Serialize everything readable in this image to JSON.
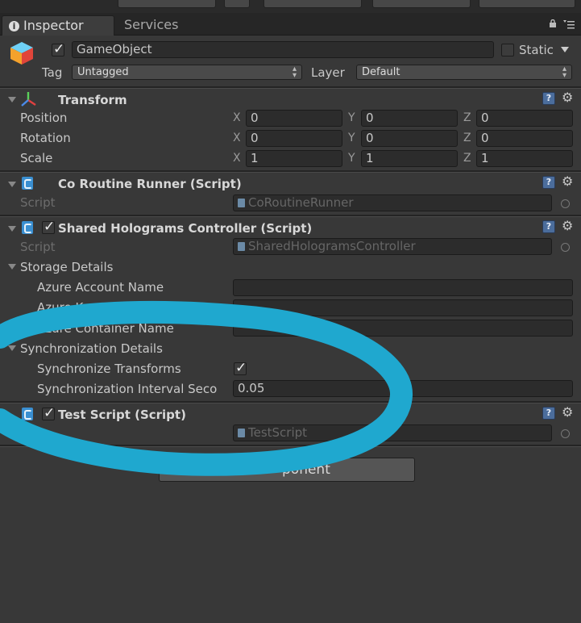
{
  "tabs": [
    {
      "label": "Inspector",
      "active": true
    },
    {
      "label": "Services",
      "active": false
    }
  ],
  "header": {
    "object_name": "GameObject",
    "active": true,
    "static_label": "Static",
    "tag_label": "Tag",
    "tag_value": "Untagged",
    "layer_label": "Layer",
    "layer_value": "Default"
  },
  "transform": {
    "title": "Transform",
    "rows": [
      {
        "label": "Position",
        "x": "0",
        "y": "0",
        "z": "0"
      },
      {
        "label": "Rotation",
        "x": "0",
        "y": "0",
        "z": "0"
      },
      {
        "label": "Scale",
        "x": "1",
        "y": "1",
        "z": "1"
      }
    ],
    "axis_x": "X",
    "axis_y": "Y",
    "axis_z": "Z"
  },
  "components": {
    "coroutine": {
      "title": "Co Routine Runner (Script)",
      "script_label": "Script",
      "script_value": "CoRoutineRunner"
    },
    "shared": {
      "title": "Shared Holograms Controller (Script)",
      "script_label": "Script",
      "script_value": "SharedHologramsController",
      "storage_title": "Storage Details",
      "azure_account": "Azure Account Name",
      "azure_key": "Azure Key Base 64",
      "azure_container": "Azure Container Name",
      "sync_title": "Synchronization Details",
      "sync_transforms": "Synchronize Transforms",
      "sync_interval": "Synchronization Interval Seco",
      "sync_interval_value": "0.05"
    },
    "test": {
      "title": "Test Script (Script)",
      "script_value": "TestScript"
    }
  },
  "add_component_label": "ponent",
  "colors": {
    "background": "#383838",
    "annotation_stroke": "#1fa8cf",
    "help_icon": "#4b6d9c"
  }
}
